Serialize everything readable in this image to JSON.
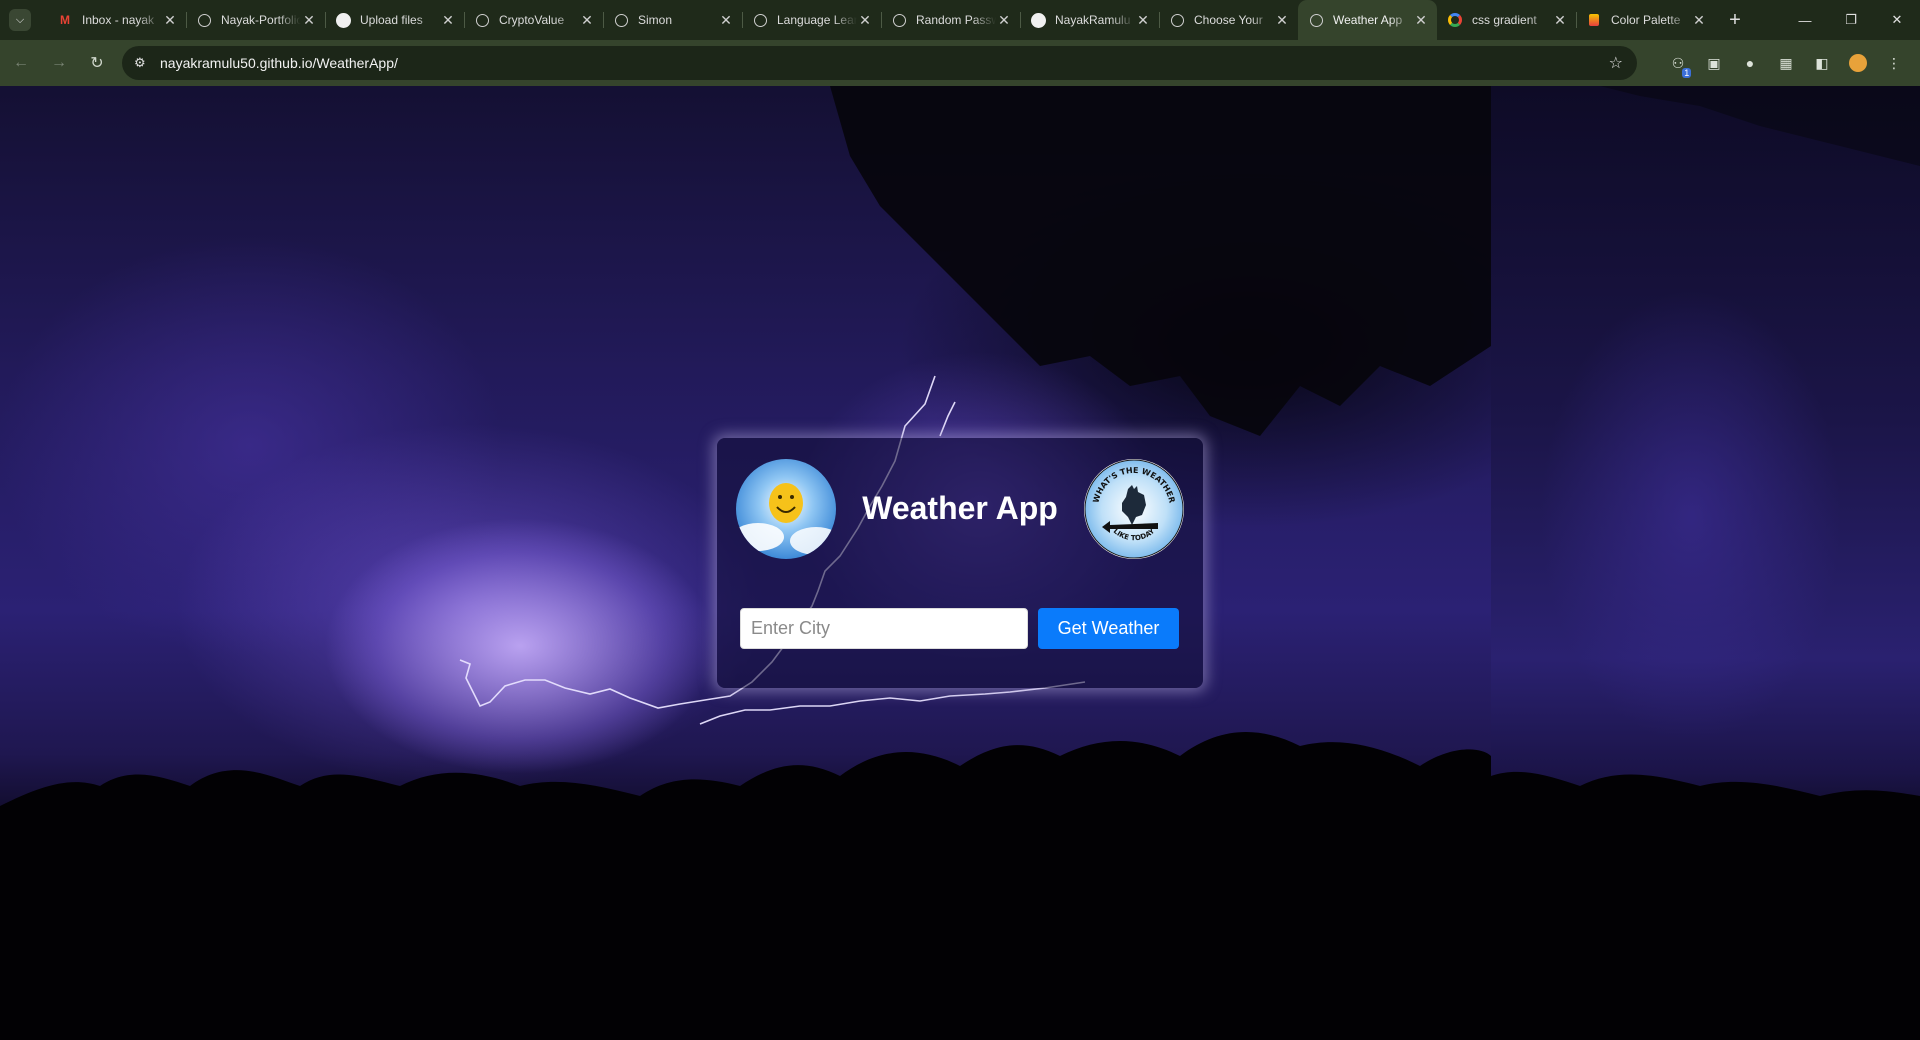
{
  "browser": {
    "tabs": [
      {
        "title": "Inbox - nayak",
        "favicon": "gmail-icon",
        "active": false
      },
      {
        "title": "Nayak-Portfolio",
        "favicon": "globe-icon",
        "active": false
      },
      {
        "title": "Upload files",
        "favicon": "github-icon",
        "active": false
      },
      {
        "title": "CryptoValue",
        "favicon": "globe-icon",
        "active": false
      },
      {
        "title": "Simon",
        "favicon": "globe-icon",
        "active": false
      },
      {
        "title": "Language Learning",
        "favicon": "globe-icon",
        "active": false
      },
      {
        "title": "Random Password",
        "favicon": "globe-icon",
        "active": false
      },
      {
        "title": "NayakRamulu",
        "favicon": "github-icon",
        "active": false
      },
      {
        "title": "Choose Your",
        "favicon": "globe-icon",
        "active": false
      },
      {
        "title": "Weather App",
        "favicon": "globe-icon",
        "active": true
      },
      {
        "title": "css gradient",
        "favicon": "google-icon",
        "active": false
      },
      {
        "title": "Color Palette",
        "favicon": "palette-icon",
        "active": false
      }
    ],
    "url": "nayakramulu50.github.io/WeatherApp/",
    "extension_badge": "1"
  },
  "app": {
    "title": "Weather App",
    "city_placeholder": "Enter City",
    "city_value": "",
    "button_label": "Get Weather",
    "rooster_logo_text_top": "WHAT'S THE WEATHER",
    "rooster_logo_text_bottom": "LIKE TODAY"
  },
  "colors": {
    "button": "#0a7bfb",
    "tabbar": "#1f2a1a",
    "toolbar": "#35442c"
  }
}
